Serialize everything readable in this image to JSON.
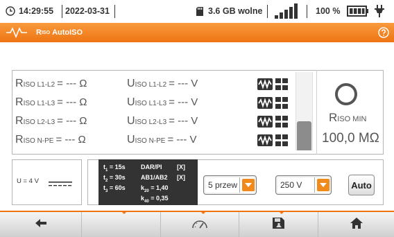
{
  "status": {
    "time": "14:29:55",
    "date": "2022-03-31",
    "storage": "3.6 GB wolne",
    "battery": "100 %"
  },
  "title": {
    "symbol": "R",
    "subscript": "ISO",
    "text": "AutoISO"
  },
  "readings": [
    {
      "r_sub": "ISO L1-L2",
      "r_value": "= --- Ω",
      "u_sub": "ISO L1-L2",
      "u_value": "= --- V"
    },
    {
      "r_sub": "ISO L1-L3",
      "r_value": "= --- Ω",
      "u_sub": "ISO L1-L3",
      "u_value": "= --- V"
    },
    {
      "r_sub": "ISO L2-L3",
      "r_value": "= --- Ω",
      "u_sub": "ISO L2-L3",
      "u_value": "= --- V"
    },
    {
      "r_sub": "ISO N-PE",
      "r_value": "= --- Ω",
      "u_sub": "ISO N-PE",
      "u_value": "= --- V"
    }
  ],
  "r_symbol": "R",
  "u_symbol": "U",
  "bar_level": 0.37,
  "rmin": {
    "symbol": "R",
    "subscript": "ISO MIN",
    "value": "100,0 MΩ"
  },
  "voltage_indicator": "U = 4 V",
  "settings": {
    "t1": "= 15s",
    "t2": "= 30s",
    "t3": "= 60s",
    "dar_pi": "DAR/PI",
    "dar_pi_flag": "[X]",
    "ab": "AB1/AB2",
    "ab_flag": "[X]",
    "k20": "= 1,40",
    "k40": "= 0,35"
  },
  "wires_select": {
    "value": "5 przew"
  },
  "voltage_select": {
    "value": "250 V"
  },
  "auto_button": "Auto",
  "colors": {
    "accent": "#EE7412",
    "text": "#555555",
    "bar": "#8C8C8C"
  },
  "icons": {
    "status": [
      "clock-icon",
      "sd-card-icon",
      "signal-icon",
      "battery-icon",
      "power-plug-icon"
    ],
    "title": [
      "waveform-icon",
      "help-icon"
    ],
    "nav": [
      "back-arrow-icon",
      "gauge-icon",
      "save-icon",
      "home-icon"
    ]
  }
}
